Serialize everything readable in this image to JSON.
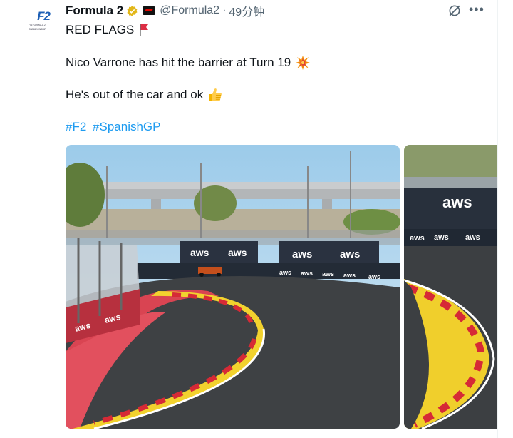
{
  "tweet": {
    "author_name": "Formula 2",
    "handle": "@Formula2",
    "separator": "·",
    "time": "49分钟",
    "avatar": {
      "logo_text": "F2",
      "sub_text": "FIA FORMULA 2 CHAMPIONSHIP"
    },
    "lines": [
      {
        "text": "RED FLAGS",
        "emoji": "red-flag-icon"
      },
      {
        "text": "Nico Varrone has hit the barrier at Turn 19",
        "emoji": "collision-icon"
      },
      {
        "text": "He's out of the car and ok",
        "emoji": "thumbs-up-icon"
      }
    ],
    "hashtags": [
      "#F2",
      "#SpanishGP"
    ]
  },
  "media": {
    "images": [
      {
        "description_key": "track-photo-turn-19",
        "sponsor": "aws"
      },
      {
        "description_key": "track-photo-second",
        "sponsor": "aws"
      }
    ]
  },
  "colors": {
    "link": "#1d9bf0",
    "muted": "#536471",
    "text": "#0f1419",
    "verified": "#f5c518"
  }
}
